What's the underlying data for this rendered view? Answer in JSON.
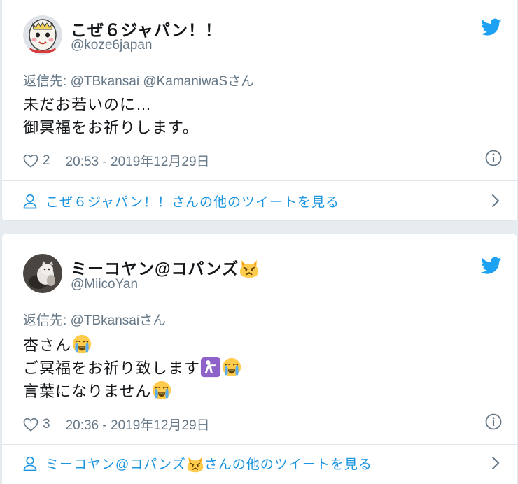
{
  "tweets": [
    {
      "name": "こぜ６ジャパン！！",
      "handle": "@koze6japan",
      "reply_prefix": "返信先:",
      "reply_to": "@TBkansai @KamaniwaS",
      "reply_suffix": "さん",
      "lines": [
        "未だお若いのに…",
        "御冥福をお祈りします。"
      ],
      "likes": "2",
      "timestamp": "20:53 - 2019年12月29日",
      "more_link": "こぜ６ジャパン！！さんの他のツイートを見る",
      "avatar_icon": "koze-mascot-avatar"
    },
    {
      "name": "ミーコヤン@コパンズ",
      "handle": "@MiicoYan",
      "reply_prefix": "返信先:",
      "reply_to": "@TBkansai",
      "reply_suffix": "さん",
      "line1": "杏さん",
      "line2": "ご冥福をお祈り致します",
      "line3": "言葉になりません",
      "likes": "3",
      "timestamp": "20:36 - 2019年12月29日",
      "more_prefix": "ミーコヤン@コパンズ",
      "more_suffix": "さんの他のツイートを見る",
      "avatar_icon": "cat-photo-avatar"
    }
  ],
  "icons": {
    "twitter_bird": "twitter-bird-icon",
    "heart": "heart-icon",
    "info": "info-icon",
    "person": "person-icon",
    "chevron": "chevron-right-icon",
    "pouting_cat": "pouting-cat-emoji",
    "crying_face": "loudly-crying-face-emoji",
    "person_bowing": "person-bowing-emoji"
  },
  "colors": {
    "link_blue": "#1b95e0",
    "bird_blue": "#1da1f2",
    "secondary_gray": "#657786",
    "text": "#14171a"
  }
}
